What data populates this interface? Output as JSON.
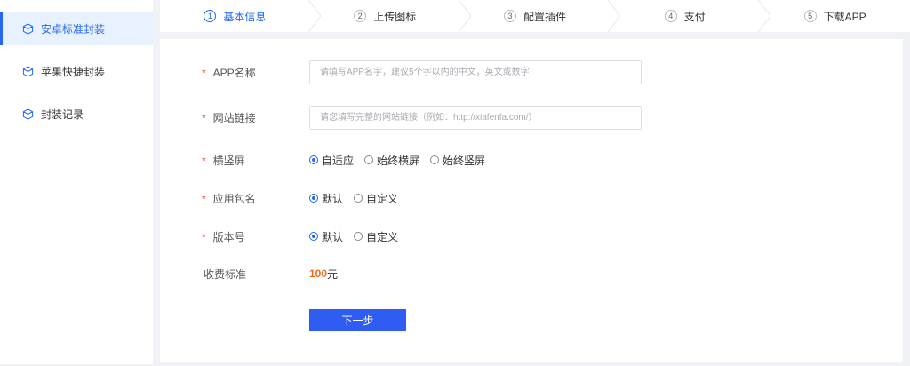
{
  "colors": {
    "accent": "#2468f2",
    "price": "#f26b1d",
    "required": "#e53e30",
    "button": "#2f5df2"
  },
  "sidebar": {
    "items": [
      {
        "label": "安卓标准封装",
        "icon": "cube-icon",
        "active": true
      },
      {
        "label": "苹果快捷封装",
        "icon": "cube-icon",
        "active": false
      },
      {
        "label": "封装记录",
        "icon": "cube-icon",
        "active": false
      }
    ]
  },
  "steps": [
    {
      "num": "1",
      "label": "基本信息",
      "active": true
    },
    {
      "num": "2",
      "label": "上传图标",
      "active": false
    },
    {
      "num": "3",
      "label": "配置插件",
      "active": false
    },
    {
      "num": "4",
      "label": "支付",
      "active": false
    },
    {
      "num": "5",
      "label": "下载APP",
      "active": false
    }
  ],
  "form": {
    "required_mark": "*",
    "app_name": {
      "label": "APP名称",
      "value": "",
      "placeholder": "请填写APP名字，建议5个字以内的中文，英文或数字"
    },
    "site_url": {
      "label": "网站链接",
      "value": "",
      "placeholder": "请您填写完整的网站链接（例如：http://xiafenfa.com/）"
    },
    "orientation": {
      "label": "横竖屏",
      "options": [
        "自适应",
        "始终横屏",
        "始终竖屏"
      ],
      "selected": "自适应"
    },
    "package_name": {
      "label": "应用包名",
      "options": [
        "默认",
        "自定义"
      ],
      "selected": "默认"
    },
    "version": {
      "label": "版本号",
      "options": [
        "默认",
        "自定义"
      ],
      "selected": "默认"
    },
    "fee": {
      "label": "收费标准",
      "amount": "100",
      "unit": "元"
    },
    "next_button": "下一步"
  }
}
